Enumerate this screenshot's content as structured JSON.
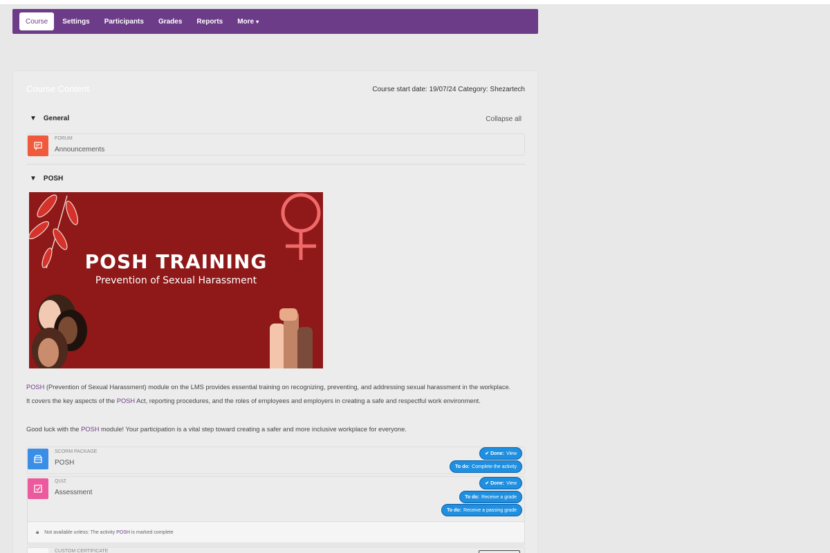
{
  "nav": {
    "tabs": [
      {
        "label": "Course"
      },
      {
        "label": "Settings"
      },
      {
        "label": "Participants"
      },
      {
        "label": "Grades"
      },
      {
        "label": "Reports"
      },
      {
        "label": "More"
      }
    ]
  },
  "course": {
    "heading": "Course Content",
    "meta": "Course start date: 19/07/24   Category: Shezartech",
    "collapse_all": "Collapse all"
  },
  "sections": {
    "general": {
      "title": "General",
      "activity": {
        "type": "FORUM",
        "name": "Announcements",
        "icon": "forum-icon",
        "color": "#f05a3c"
      }
    },
    "posh": {
      "title": "POSH",
      "banner": {
        "title": "POSH TRAINING",
        "subtitle": "Prevention of Sexual Harassment"
      },
      "para1_a": "POSH",
      "para1_b": " (Prevention of Sexual Harassment) module on the LMS provides essential training on recognizing, preventing, and addressing sexual harassment in the workplace.",
      "para2_a": "It covers the key aspects of the ",
      "para2_b": "POSH",
      "para2_c": " Act, reporting procedures, and the roles of employees and employers in creating a safe and respectful work environment.",
      "para3_a": "Good luck with the ",
      "para3_b": "POSH",
      "para3_c": " module! Your participation is a vital step toward creating a safer and more inclusive workplace for everyone.",
      "scorm": {
        "type": "SCORM PACKAGE",
        "name": "POSH",
        "icon": "package-icon",
        "color": "#3a8ee6",
        "badge_done_label": "✔ Done:",
        "badge_done_value": "View",
        "badge_todo_label": "To do:",
        "badge_todo_value": "Complete the activity"
      },
      "quiz": {
        "type": "QUIZ",
        "name": "Assessment",
        "icon": "quiz-icon",
        "color": "#ea5a9c",
        "badge_done_label": "✔ Done:",
        "badge_done_value": "View",
        "badge_grade_label": "To do:",
        "badge_grade_value": "Receive a grade",
        "badge_pass_label": "To do:",
        "badge_pass_value": "Receive a passing grade"
      },
      "restriction": {
        "text_a": "Not available unless: The activity",
        "text_b": "POSH",
        "text_c": "is marked complete"
      },
      "certificate": {
        "type": "CUSTOM CERTIFICATE"
      }
    }
  }
}
